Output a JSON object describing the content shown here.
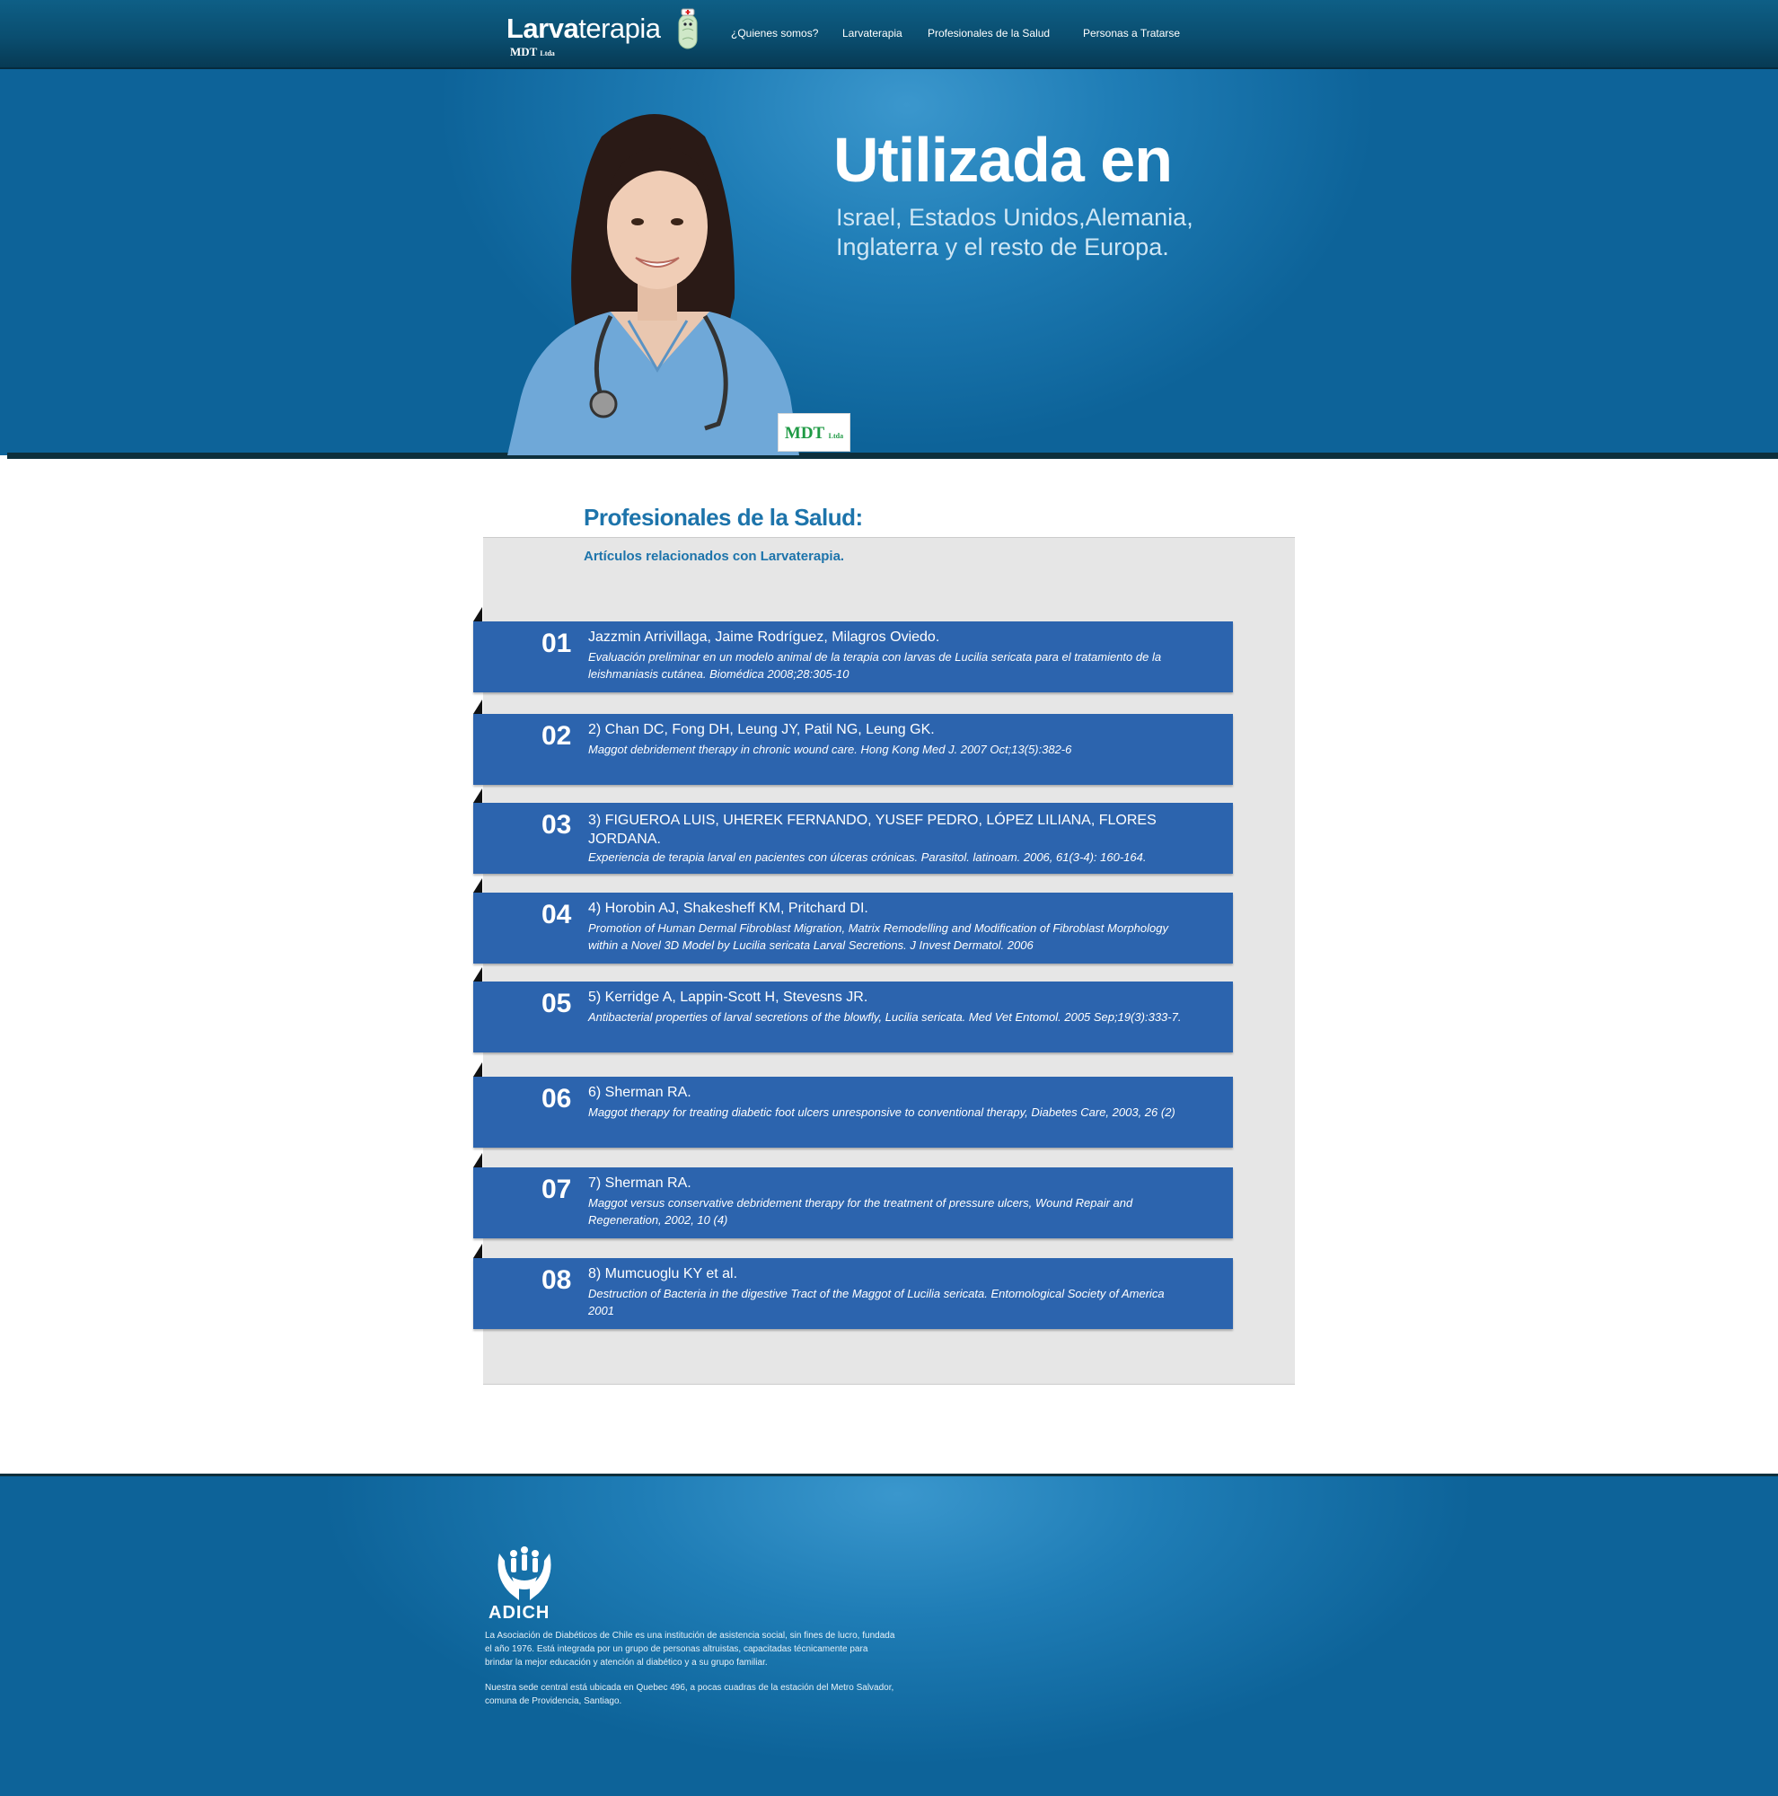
{
  "nav": {
    "logo_bold": "Larva",
    "logo_rest": "terapia",
    "logo_sub": "MDT",
    "logo_sub_small": "Ltda",
    "items": [
      "¿Quienes somos?",
      "Larvaterapia",
      "Profesionales de la Salud",
      "Personas a Tratarse"
    ]
  },
  "hero": {
    "title": "Utilizada en",
    "subtitle_line1": "Israel, Estados Unidos,Alemania,",
    "subtitle_line2": "Inglaterra y el resto de Europa.",
    "badge": "MDT",
    "badge_small": "Ltda"
  },
  "content": {
    "title": "Profesionales de la Salud:",
    "subtitle": "Artículos relacionados con Larvaterapia.",
    "articles": [
      {
        "num": "01",
        "head": "Jazzmin Arrivillaga, Jaime Rodríguez, Milagros Oviedo.",
        "body": "Evaluación preliminar en un modelo animal de la terapia con larvas de Lucilia sericata para el tratamiento de la leishmaniasis cutánea. Biomédica 2008;28:305-10"
      },
      {
        "num": "02",
        "head": "2)      Chan DC, Fong DH, Leung JY, Patil NG, Leung GK.",
        "body": "Maggot debridement therapy in chronic wound care. Hong Kong Med J. 2007 Oct;13(5):382-6"
      },
      {
        "num": "03",
        "head": "3)      FIGUEROA LUIS, UHEREK FERNANDO, YUSEF PEDRO, LÓPEZ LILIANA, FLORES JORDANA.",
        "body": "Experiencia de terapia larval en pacientes con úlceras crónicas. Parasitol. latinoam. 2006, 61(3-4): 160-164."
      },
      {
        "num": "04",
        "head": "4)      Horobin AJ, Shakesheff KM, Pritchard DI.",
        "body": "Promotion of Human Dermal Fibroblast Migration, Matrix Remodelling and Modification of Fibroblast Morphology within a Novel 3D Model by Lucilia sericata Larval Secretions. J Invest Dermatol. 2006"
      },
      {
        "num": "05",
        "head": "5)      Kerridge A, Lappin-Scott H, Stevesns JR.",
        "body": "Antibacterial properties of larval secretions of the blowfly, Lucilia sericata. Med Vet Entomol. 2005 Sep;19(3):333-7."
      },
      {
        "num": "06",
        "head": "6)      Sherman RA.",
        "body": " Maggot therapy for treating diabetic foot ulcers unresponsive to conventional therapy, Diabetes Care, 2003, 26 (2)"
      },
      {
        "num": "07",
        "head": "7)      Sherman RA.",
        "body": "Maggot versus conservative debridement therapy for the treatment of pressure ulcers, Wound Repair and Regeneration, 2002, 10 (4)"
      },
      {
        "num": "08",
        "head": "8)      Mumcuoglu KY et al.",
        "body": "Destruction of Bacteria in the digestive Tract of the Maggot of Lucilia sericata. Entomological Society of America 2001"
      }
    ]
  },
  "footer": {
    "org": "ADICH",
    "para1": "La Asociación de Diabéticos de Chile es una institución de asistencia social, sin fines de lucro, fundada el año 1976. Está integrada por un grupo de personas altruistas, capacitadas técnicamente para brindar la mejor educación y atención al diabético y a su grupo familiar.",
    "para2": "Nuestra sede central está ubicada en Quebec 496, a pocas cuadras de la estación del Metro Salvador, comuna de Providencia, Santiago."
  }
}
